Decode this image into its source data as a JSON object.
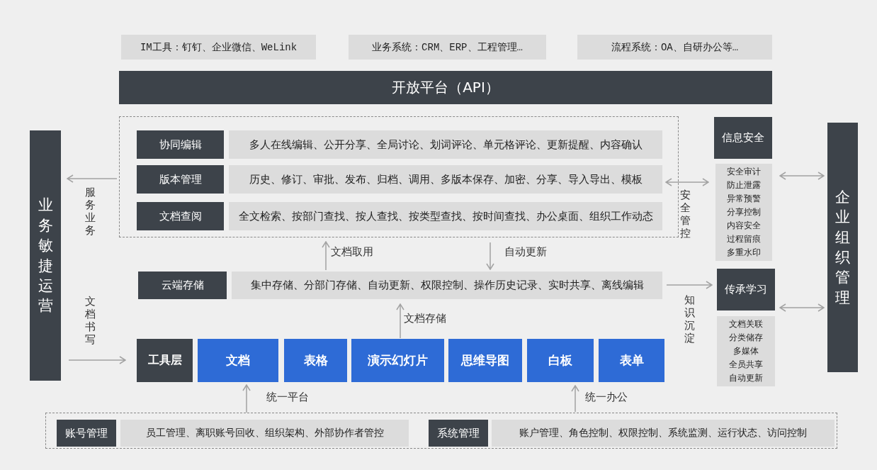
{
  "top_systems": [
    "IM工具：钉钉、企业微信、WeLink",
    "业务系统：CRM、ERP、工程管理…",
    "流程系统：OA、自研办公等…"
  ],
  "open_platform": "开放平台（API）",
  "left_pillar": "业务敏捷运营",
  "right_pillar": "企业组织管理",
  "capabilities": [
    {
      "label": "协同编辑",
      "content": "多人在线编辑、公开分享、全局讨论、划词评论、单元格评论、更新提醒、内容确认"
    },
    {
      "label": "版本管理",
      "content": "历史、修订、审批、发布、归档、调用、多版本保存、加密、分享、导入导出、模板"
    },
    {
      "label": "文档查阅",
      "content": "全文检索、按部门查找、按人查找、按类型查找、按时间查找、办公桌面、组织工作动态"
    }
  ],
  "cloud_storage": {
    "label": "云端存储",
    "content": "集中存储、分部门存储、自动更新、权限控制、操作历史记录、实时共享、离线编辑"
  },
  "tools": {
    "label": "工具层",
    "items": [
      "文档",
      "表格",
      "演示幻灯片",
      "思维导图",
      "白板",
      "表单"
    ]
  },
  "security": {
    "title": "信息安全",
    "items": [
      "安全审计",
      "防止泄露",
      "异常预警",
      "分享控制",
      "内容安全",
      "过程留痕",
      "多重水印"
    ]
  },
  "knowledge": {
    "title": "传承学习",
    "items": [
      "文档关联",
      "分类储存",
      "多媒体",
      "全员共享",
      "自动更新"
    ]
  },
  "management": [
    {
      "label": "账号管理",
      "content": "员工管理、离职账号回收、组织架构、外部协作者管控"
    },
    {
      "label": "系统管理",
      "content": "账户管理、角色控制、权限控制、系统监测、运行状态、访问控制"
    }
  ],
  "flow_labels": {
    "service": "服务业务",
    "writing": "文档书写",
    "fetch": "文档取用",
    "auto_update": "自动更新",
    "storage": "文档存储",
    "unified_platform": "统一平台",
    "unified_office": "统一办公",
    "security_control": "安全管控",
    "knowledge": "知识沉淀"
  }
}
